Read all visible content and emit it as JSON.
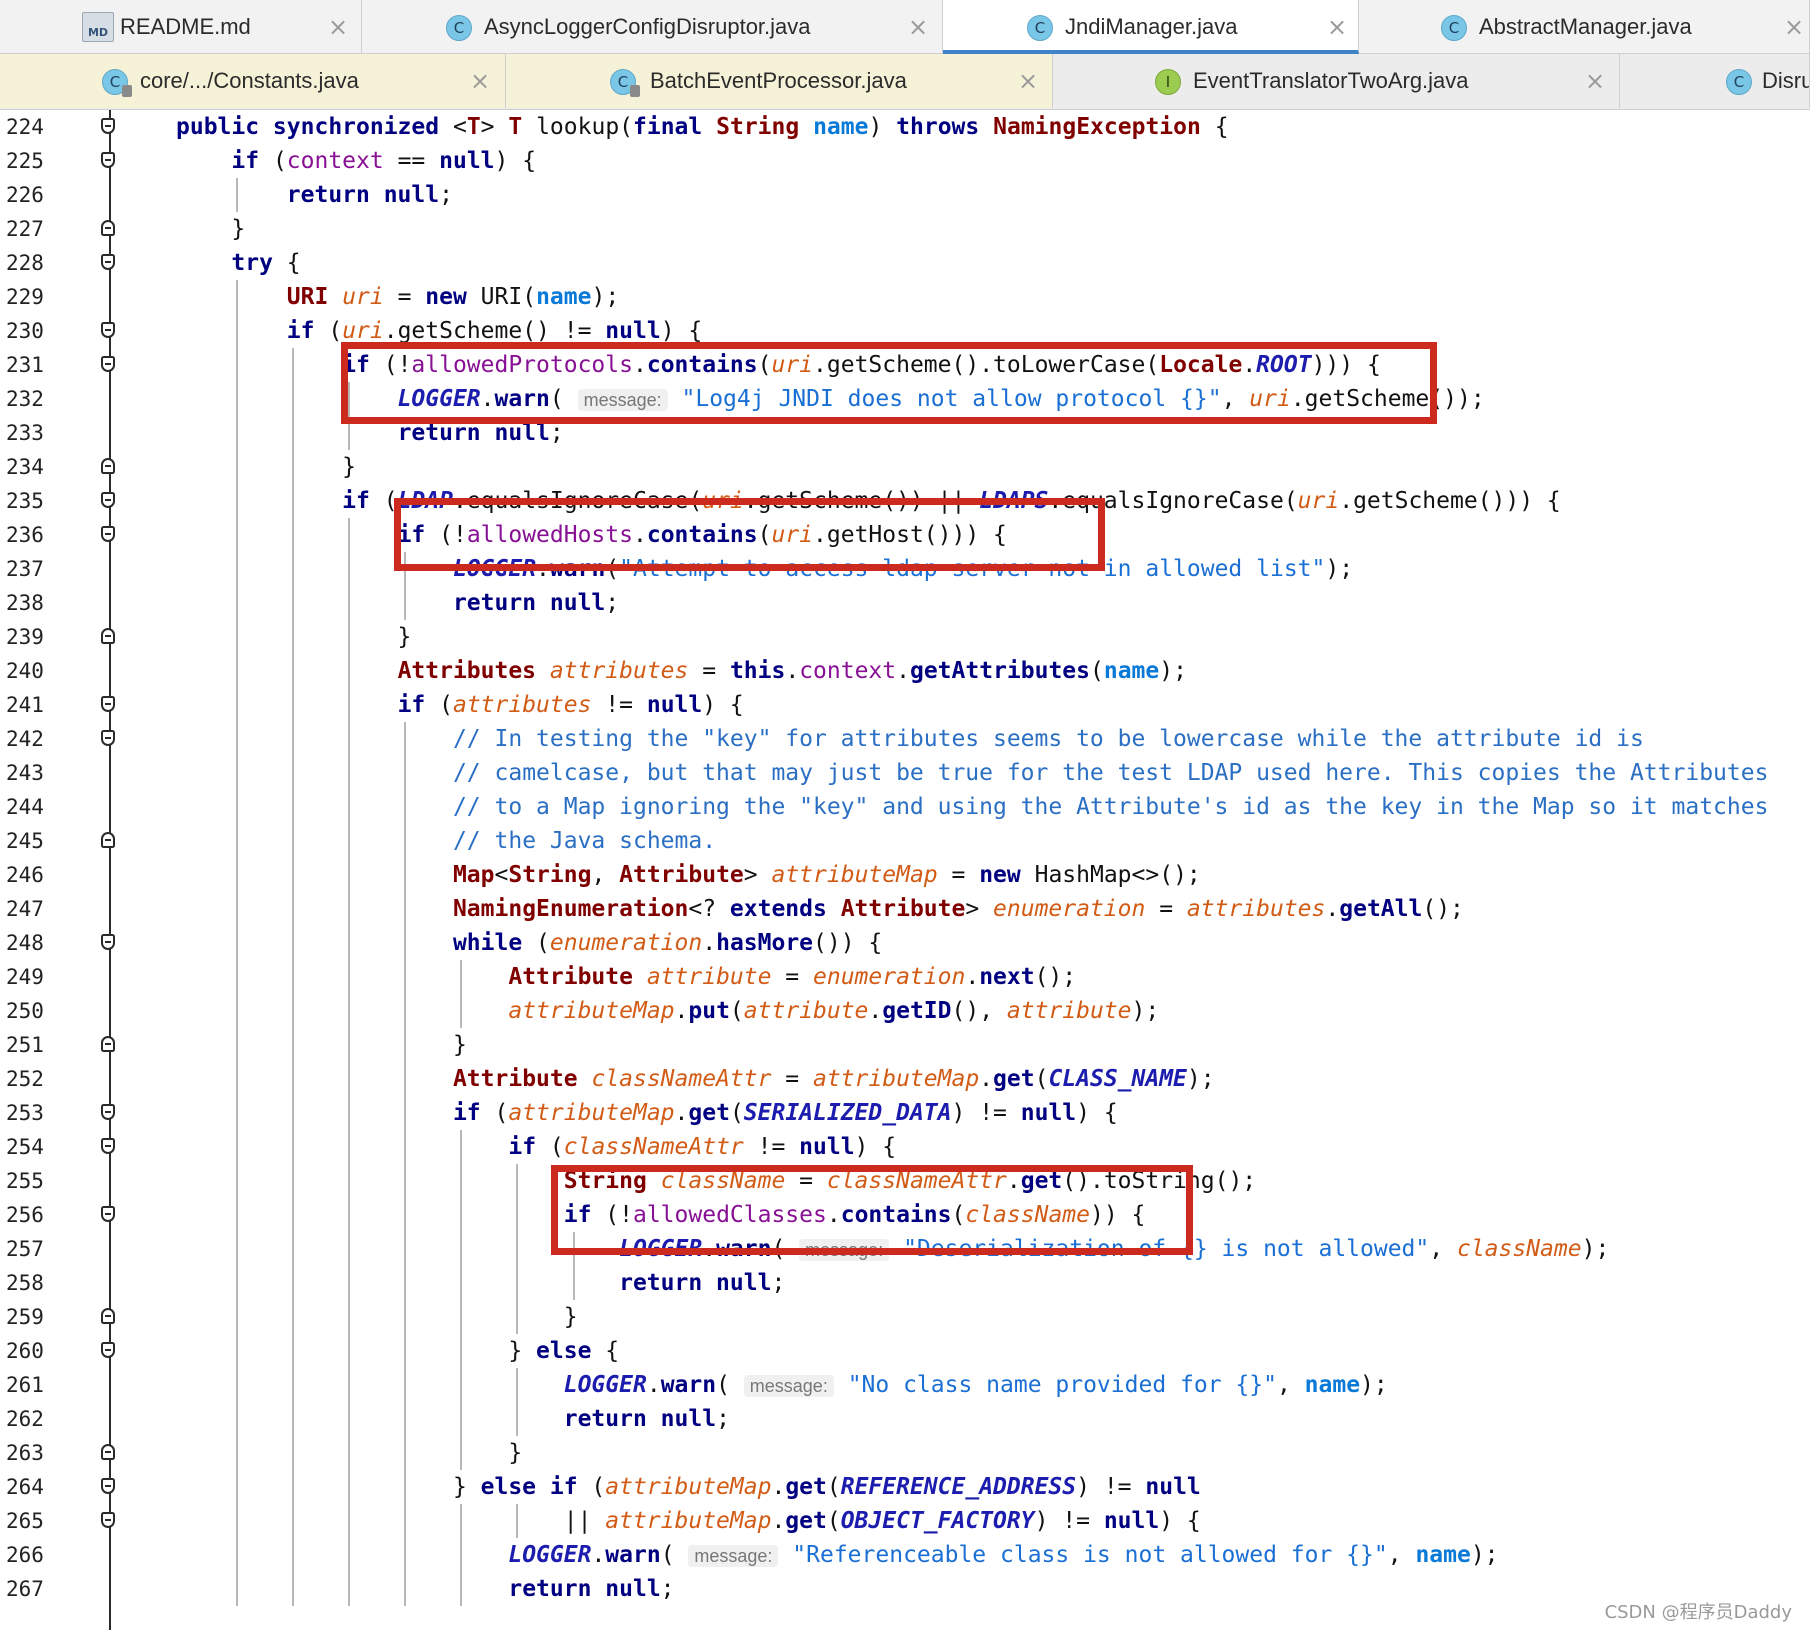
{
  "tabs_row1": [
    {
      "label": "README.md",
      "icon": "markdown-file-icon",
      "icon_glyph": "MD",
      "kind": "md",
      "active": false
    },
    {
      "label": "AsyncLoggerConfigDisruptor.java",
      "icon": "java-class-icon",
      "icon_glyph": "C",
      "kind": "class",
      "active": false
    },
    {
      "label": "JndiManager.java",
      "icon": "java-class-icon",
      "icon_glyph": "C",
      "kind": "class",
      "active": true
    },
    {
      "label": "AbstractManager.java",
      "icon": "java-abstract-class-icon",
      "icon_glyph": "C",
      "kind": "class",
      "active": false
    }
  ],
  "tabs_row2": [
    {
      "label": "core/.../Constants.java",
      "icon": "java-class-icon",
      "icon_glyph": "C",
      "kind": "class",
      "locked": true
    },
    {
      "label": "BatchEventProcessor.java",
      "icon": "java-class-icon",
      "icon_glyph": "C",
      "kind": "class",
      "locked": true
    },
    {
      "label": "EventTranslatorTwoArg.java",
      "icon": "java-interface-icon",
      "icon_glyph": "I",
      "kind": "iface",
      "locked": false
    },
    {
      "label": "Disru",
      "icon": "java-class-icon",
      "icon_glyph": "C",
      "kind": "class",
      "locked": false
    }
  ],
  "close_glyph": "×",
  "editor": {
    "lines": [
      {
        "n": "224",
        "fold": "open",
        "html": "<span class='kw'>public synchronized</span> &lt;<span class='ty'>T</span>&gt; <span class='ty'>T</span> lookup(<span class='kw'>final</span> <span class='ty'>String</span> <span class='par'>name</span>) <span class='kw'>throws</span> <span class='ty'>NamingException</span> {"
      },
      {
        "n": "225",
        "fold": "open",
        "html": "    <span class='kw'>if</span> (<span class='fld'>context</span> == <span class='kw'>null</span>) {"
      },
      {
        "n": "226",
        "fold": "",
        "html": "        <span class='kw'>return null</span>;"
      },
      {
        "n": "227",
        "fold": "close",
        "html": "    }"
      },
      {
        "n": "228",
        "fold": "open",
        "html": "    <span class='kw'>try</span> {"
      },
      {
        "n": "229",
        "fold": "",
        "html": "        <span class='ty'>URI</span> <span class='loc'>uri</span> = <span class='kw'>new</span> URI(<span class='par'>name</span>);"
      },
      {
        "n": "230",
        "fold": "open",
        "html": "        <span class='kw'>if</span> (<span class='loc'>uri</span>.getScheme() != <span class='kw'>null</span>) {"
      },
      {
        "n": "231",
        "fold": "open",
        "html": "            <span class='kw'>if</span> (!<span class='fld'>allowedProtocols</span>.<span class='kw'>contains</span>(<span class='loc'>uri</span>.getScheme().toLowerCase(<span class='ty'>Locale</span>.<span class='cst'>ROOT</span>))) {"
      },
      {
        "n": "232",
        "fold": "",
        "html": "                <span class='cst'>LOGGER</span>.<span class='kw'>warn</span>( <span class='hint'>message:</span> <span class='str'>\"Log4j JNDI does not allow protocol {}\"</span>, <span class='loc'>uri</span>.getScheme());"
      },
      {
        "n": "233",
        "fold": "",
        "html": "                <span class='kw'>return null</span>;"
      },
      {
        "n": "234",
        "fold": "close",
        "html": "            }"
      },
      {
        "n": "235",
        "fold": "open",
        "html": "            <span class='kw'>if</span> (<span class='cst'>LDAP</span>.equalsIgnoreCase(<span class='loc'>uri</span>.getScheme()) || <span class='cst'>LDAPS</span>.equalsIgnoreCase(<span class='loc'>uri</span>.getScheme())) {"
      },
      {
        "n": "236",
        "fold": "open",
        "html": "                <span class='kw'>if</span> (!<span class='fld'>allowedHosts</span>.<span class='kw'>contains</span>(<span class='loc'>uri</span>.getHost())) {"
      },
      {
        "n": "237",
        "fold": "",
        "html": "                    <span class='cst'>LOGGER</span>.<span class='kw'>warn</span>(<span class='str'>\"Attempt to access ldap server not in allowed list\"</span>);"
      },
      {
        "n": "238",
        "fold": "",
        "html": "                    <span class='kw'>return null</span>;"
      },
      {
        "n": "239",
        "fold": "close",
        "html": "                }"
      },
      {
        "n": "240",
        "fold": "",
        "html": "                <span class='ty'>Attributes</span> <span class='loc'>attributes</span> = <span class='kw'>this</span>.<span class='fld'>context</span>.<span class='kw'>getAttributes</span>(<span class='par'>name</span>);"
      },
      {
        "n": "241",
        "fold": "open",
        "html": "                <span class='kw'>if</span> (<span class='loc'>attributes</span> != <span class='kw'>null</span>) {"
      },
      {
        "n": "242",
        "fold": "open",
        "html": "                    <span class='cmt'>// In testing the \"key\" for attributes seems to be lowercase while the attribute id is</span>"
      },
      {
        "n": "243",
        "fold": "",
        "html": "                    <span class='cmt'>// camelcase, but that may just be true for the test LDAP used here. This copies the Attributes</span>"
      },
      {
        "n": "244",
        "fold": "",
        "html": "                    <span class='cmt'>// to a Map ignoring the \"key\" and using the Attribute's id as the key in the Map so it matches</span>"
      },
      {
        "n": "245",
        "fold": "close",
        "html": "                    <span class='cmt'>// the Java schema.</span>"
      },
      {
        "n": "246",
        "fold": "",
        "html": "                    <span class='ty'>Map</span>&lt;<span class='ty'>String</span>, <span class='ty'>Attribute</span>&gt; <span class='loc'>attributeMap</span> = <span class='kw'>new</span> HashMap&lt;&gt;();"
      },
      {
        "n": "247",
        "fold": "",
        "html": "                    <span class='ty'>NamingEnumeration</span>&lt;? <span class='kw'>extends</span> <span class='ty'>Attribute</span>&gt; <span class='loc'>enumeration</span> = <span class='loc'>attributes</span>.<span class='kw'>getAll</span>();"
      },
      {
        "n": "248",
        "fold": "open",
        "html": "                    <span class='kw'>while</span> (<span class='loc'>enumeration</span>.<span class='kw'>hasMore</span>()) {"
      },
      {
        "n": "249",
        "fold": "",
        "html": "                        <span class='ty'>Attribute</span> <span class='loc'>attribute</span> = <span class='loc'>enumeration</span>.<span class='kw'>next</span>();"
      },
      {
        "n": "250",
        "fold": "",
        "html": "                        <span class='loc'>attributeMap</span>.<span class='kw'>put</span>(<span class='loc'>attribute</span>.<span class='kw'>getID</span>(), <span class='loc'>attribute</span>);"
      },
      {
        "n": "251",
        "fold": "close",
        "html": "                    }"
      },
      {
        "n": "252",
        "fold": "",
        "html": "                    <span class='ty'>Attribute</span> <span class='loc'>classNameAttr</span> = <span class='loc'>attributeMap</span>.<span class='kw'>get</span>(<span class='cst'>CLASS_NAME</span>);"
      },
      {
        "n": "253",
        "fold": "open",
        "html": "                    <span class='kw'>if</span> (<span class='loc'>attributeMap</span>.<span class='kw'>get</span>(<span class='cst'>SERIALIZED_DATA</span>) != <span class='kw'>null</span>) {"
      },
      {
        "n": "254",
        "fold": "open",
        "html": "                        <span class='kw'>if</span> (<span class='loc'>classNameAttr</span> != <span class='kw'>null</span>) {"
      },
      {
        "n": "255",
        "fold": "",
        "html": "                            <span class='ty'>String</span> <span class='loc'>className</span> = <span class='loc'>classNameAttr</span>.<span class='kw'>get</span>().toString();"
      },
      {
        "n": "256",
        "fold": "open",
        "html": "                            <span class='kw'>if</span> (!<span class='fld'>allowedClasses</span>.<span class='kw'>contains</span>(<span class='loc'>className</span>)) {"
      },
      {
        "n": "257",
        "fold": "",
        "html": "                                <span class='cst'>LOGGER</span>.<span class='kw'>warn</span>( <span class='hint'>message:</span> <span class='str'>\"Deserialization of {} is not allowed\"</span>, <span class='loc'>className</span>);"
      },
      {
        "n": "258",
        "fold": "",
        "html": "                                <span class='kw'>return null</span>;"
      },
      {
        "n": "259",
        "fold": "close",
        "html": "                            }"
      },
      {
        "n": "260",
        "fold": "open",
        "html": "                        } <span class='kw'>else</span> {"
      },
      {
        "n": "261",
        "fold": "",
        "html": "                            <span class='cst'>LOGGER</span>.<span class='kw'>warn</span>( <span class='hint'>message:</span> <span class='str'>\"No class name provided for {}\"</span>, <span class='par'>name</span>);"
      },
      {
        "n": "262",
        "fold": "",
        "html": "                            <span class='kw'>return null</span>;"
      },
      {
        "n": "263",
        "fold": "close",
        "html": "                        }"
      },
      {
        "n": "264",
        "fold": "open",
        "html": "                    } <span class='kw'>else if</span> (<span class='loc'>attributeMap</span>.<span class='kw'>get</span>(<span class='cst'>REFERENCE_ADDRESS</span>) != <span class='kw'>null</span>"
      },
      {
        "n": "265",
        "fold": "open",
        "html": "                            || <span class='loc'>attributeMap</span>.<span class='kw'>get</span>(<span class='cst'>OBJECT_FACTORY</span>) != <span class='kw'>null</span>) {"
      },
      {
        "n": "266",
        "fold": "",
        "html": "                        <span class='cst'>LOGGER</span>.<span class='kw'>warn</span>( <span class='hint'>message:</span> <span class='str'>\"Referenceable class is not allowed for {}\"</span>, <span class='par'>name</span>);"
      },
      {
        "n": "267",
        "fold": "",
        "html": "                        <span class='kw'>return null</span>;"
      }
    ]
  },
  "watermark": "CSDN @程序员Daddy",
  "colors": {
    "highlight_box": "#cc2a1e",
    "active_tab_underline": "#4083c9"
  }
}
